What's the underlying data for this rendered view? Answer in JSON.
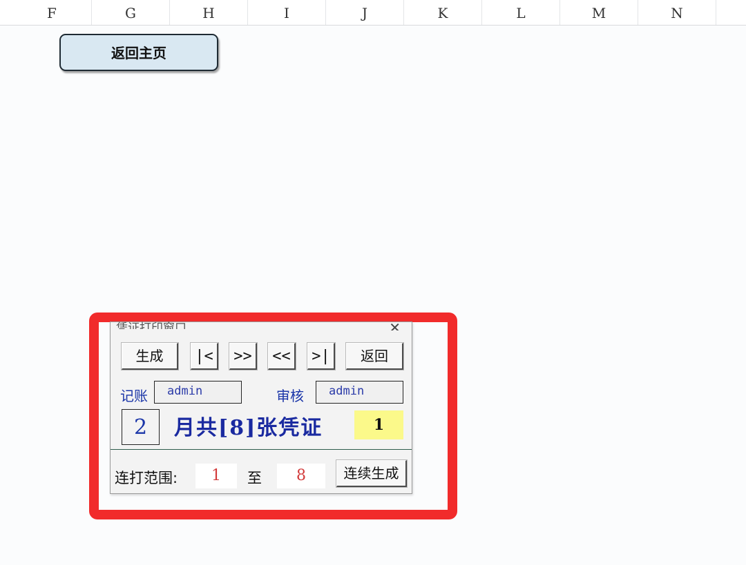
{
  "columns": [
    "F",
    "G",
    "H",
    "I",
    "J",
    "K",
    "L",
    "M",
    "N"
  ],
  "home_button": "返回主页",
  "dialog": {
    "title": "凭证打印窗口",
    "close_glyph": "✕",
    "buttons": {
      "generate": "生成",
      "first": "|<",
      "next": ">>",
      "prev": "<<",
      "last": ">|",
      "back": "返回"
    },
    "bookkeeper_label": "记账",
    "bookkeeper_value": "admin",
    "reviewer_label": "审核",
    "reviewer_value": "admin",
    "month_value": "2",
    "month_text": "月共[8]张凭证",
    "current_voucher": "1",
    "range_label": "连打范围:",
    "range_from": "1",
    "range_to_label": "至",
    "range_to": "8",
    "continuous_button": "连续生成"
  },
  "colors": {
    "highlight_frame": "#f12b2b",
    "label_blue": "#1a35a8",
    "current_voucher_bg": "#fbf98a",
    "range_value": "#d23a3a"
  }
}
